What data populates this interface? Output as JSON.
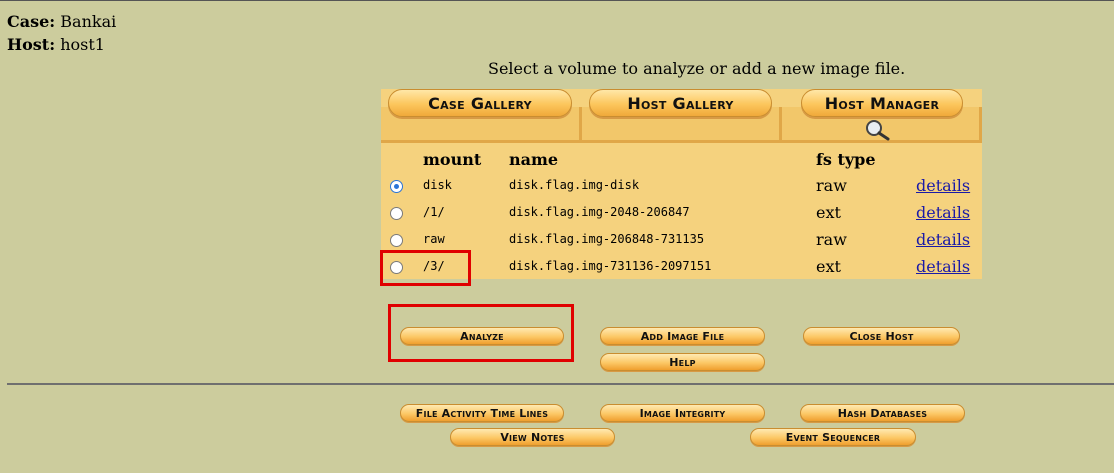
{
  "header": {
    "case_label": "Case:",
    "case_value": "Bankai",
    "host_label": "Host:",
    "host_value": "host1"
  },
  "instruction": "Select a volume to analyze or add a new image file.",
  "gallery_tabs": [
    "Case Gallery",
    "Host Gallery",
    "Host Manager"
  ],
  "table": {
    "columns": [
      "mount",
      "name",
      "fs type"
    ],
    "rows": [
      {
        "mount": "disk",
        "name": "disk.flag.img-disk",
        "fs_type": "raw",
        "link": "details",
        "selected": true
      },
      {
        "mount": "/1/",
        "name": "disk.flag.img-2048-206847",
        "fs_type": "ext",
        "link": "details",
        "selected": false
      },
      {
        "mount": "raw",
        "name": "disk.flag.img-206848-731135",
        "fs_type": "raw",
        "link": "details",
        "selected": false
      },
      {
        "mount": "/3/",
        "name": "disk.flag.img-731136-2097151",
        "fs_type": "ext",
        "link": "details",
        "selected": false
      }
    ]
  },
  "actions": {
    "analyze": "Analyze",
    "add_image_file": "Add Image File",
    "close_host": "Close Host",
    "help": "Help"
  },
  "tools": {
    "file_activity": "File Activity Time Lines",
    "image_integrity": "Image Integrity",
    "hash_databases": "Hash Databases",
    "view_notes": "View Notes",
    "event_sequencer": "Event Sequencer"
  },
  "colors": {
    "page_bg": "#cccc9d",
    "panel_bg": "#f5d27e",
    "highlight": "#e00000",
    "link": "#1a1aa8"
  }
}
